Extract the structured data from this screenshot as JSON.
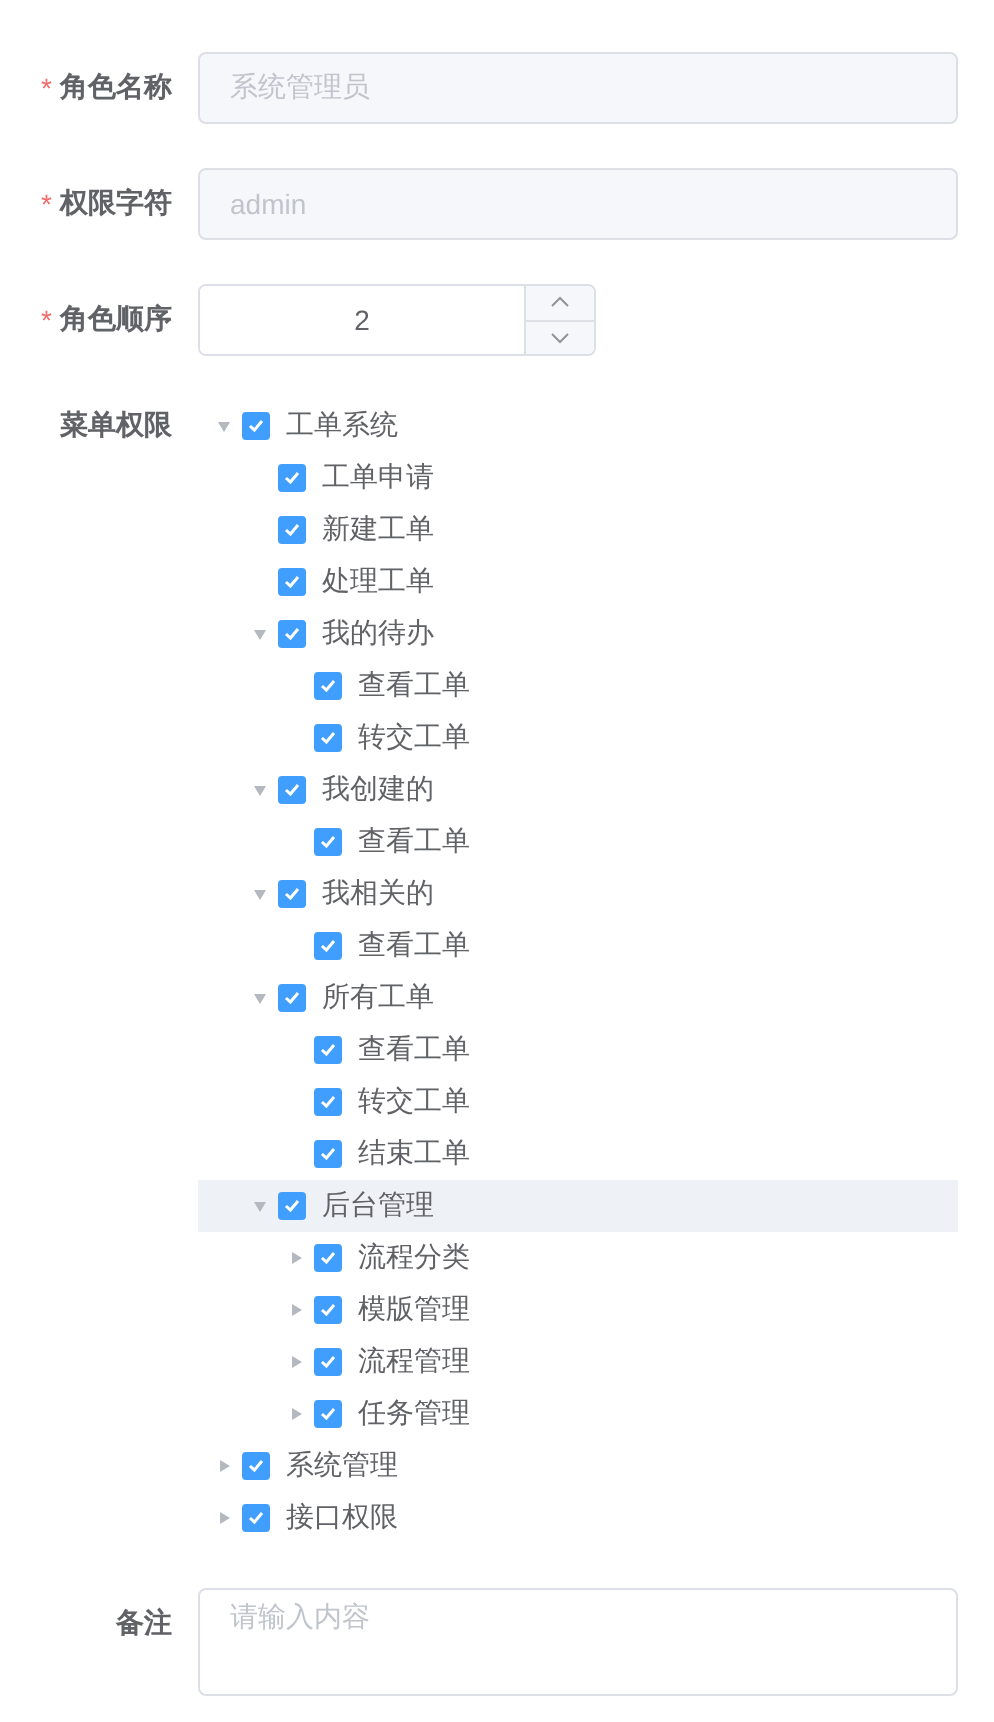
{
  "fields": [
    {
      "kind": "text",
      "label": "角色名称",
      "required_mark": "*",
      "disabled": true,
      "value": "系统管理员"
    },
    {
      "kind": "text",
      "label": "权限字符",
      "required_mark": "*",
      "disabled": true,
      "value": "admin"
    },
    {
      "kind": "number",
      "label": "角色顺序",
      "required_mark": "*",
      "disabled": false,
      "value": "2"
    }
  ],
  "menu_permissions": {
    "label": "菜单权限",
    "tree": [
      {
        "kind": "branch",
        "label": "工单系统",
        "checked": true,
        "selected": false,
        "expanded": true,
        "children": [
          {
            "kind": "leaf",
            "label": "工单申请",
            "checked": true,
            "selected": false
          },
          {
            "kind": "leaf",
            "label": "新建工单",
            "checked": true,
            "selected": false
          },
          {
            "kind": "leaf",
            "label": "处理工单",
            "checked": true,
            "selected": false
          },
          {
            "kind": "branch",
            "label": "我的待办",
            "checked": true,
            "selected": false,
            "expanded": true,
            "children": [
              {
                "kind": "leaf",
                "label": "查看工单",
                "checked": true,
                "selected": false
              },
              {
                "kind": "leaf",
                "label": "转交工单",
                "checked": true,
                "selected": false
              }
            ]
          },
          {
            "kind": "branch",
            "label": "我创建的",
            "checked": true,
            "selected": false,
            "expanded": true,
            "children": [
              {
                "kind": "leaf",
                "label": "查看工单",
                "checked": true,
                "selected": false
              }
            ]
          },
          {
            "kind": "branch",
            "label": "我相关的",
            "checked": true,
            "selected": false,
            "expanded": true,
            "children": [
              {
                "kind": "leaf",
                "label": "查看工单",
                "checked": true,
                "selected": false
              }
            ]
          },
          {
            "kind": "branch",
            "label": "所有工单",
            "checked": true,
            "selected": false,
            "expanded": true,
            "children": [
              {
                "kind": "leaf",
                "label": "查看工单",
                "checked": true,
                "selected": false
              },
              {
                "kind": "leaf",
                "label": "转交工单",
                "checked": true,
                "selected": false
              },
              {
                "kind": "leaf",
                "label": "结束工单",
                "checked": true,
                "selected": false
              }
            ]
          },
          {
            "kind": "branch",
            "label": "后台管理",
            "checked": true,
            "selected": true,
            "expanded": true,
            "children": [
              {
                "kind": "branch",
                "label": "流程分类",
                "checked": true,
                "selected": false,
                "expanded": false
              },
              {
                "kind": "branch",
                "label": "模版管理",
                "checked": true,
                "selected": false,
                "expanded": false
              },
              {
                "kind": "branch",
                "label": "流程管理",
                "checked": true,
                "selected": false,
                "expanded": false
              },
              {
                "kind": "branch",
                "label": "任务管理",
                "checked": true,
                "selected": false,
                "expanded": false
              }
            ]
          }
        ]
      },
      {
        "kind": "branch",
        "label": "系统管理",
        "checked": true,
        "selected": false,
        "expanded": false
      },
      {
        "kind": "branch",
        "label": "接口权限",
        "checked": true,
        "selected": false,
        "expanded": false
      }
    ]
  },
  "remark": {
    "label": "备注",
    "placeholder": "请输入内容"
  }
}
